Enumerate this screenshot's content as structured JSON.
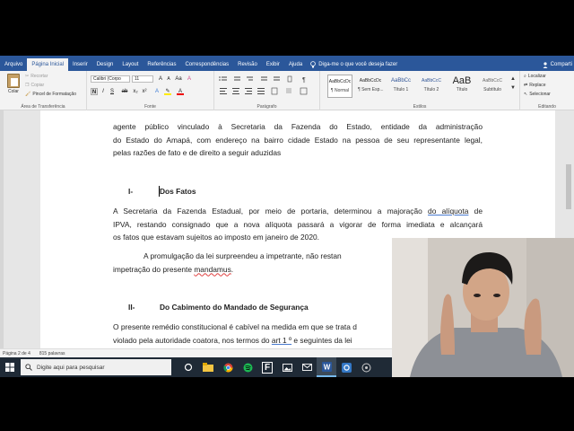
{
  "ribbon_tabs": [
    "Arquivo",
    "Página Inicial",
    "Inserir",
    "Design",
    "Layout",
    "Referências",
    "Correspondências",
    "Revisão",
    "Exibir",
    "Ajuda"
  ],
  "tell_me": "Diga-me o que você deseja fazer",
  "share": "Comparti",
  "clipboard": {
    "paste": "Colar",
    "cut": "Recortar",
    "copy": "Copiar",
    "format_painter": "Pincel de Formatação",
    "label": "Área de Transferência"
  },
  "font": {
    "name": "Calibri (Corpo",
    "size": "11",
    "label": "Fonte"
  },
  "paragraph_label": "Parágrafo",
  "styles": {
    "label": "Estilos",
    "items": [
      {
        "preview": "AaBbCcDc",
        "name": "¶ Normal"
      },
      {
        "preview": "AaBbCcDc",
        "name": "¶ Sem Esp..."
      },
      {
        "preview": "AaBbCc",
        "name": "Título 1"
      },
      {
        "preview": "AaBbCcC",
        "name": "Título 2"
      },
      {
        "preview": "AaB",
        "name": "Título"
      },
      {
        "preview": "AaBbCcC",
        "name": "Subtítulo"
      }
    ]
  },
  "editing": {
    "find": "Localizar",
    "replace": "Replace",
    "select": "Selecionar",
    "label": "Editando"
  },
  "document": {
    "p1": [
      "agente público vinculado à Secretaria da Fazenda do Estado, entidade da administração",
      "do Estado do Amapá, com endereço na bairro cidade Estado na pessoa de seu representante legal,",
      "pelas razões de fato e de direito a seguir aduzidas"
    ],
    "h1_num": "I-",
    "h1_title": "Dos Fatos",
    "p2_l1a": "A Secretaria da Fazenda Estadual, por meio de portaria, determinou a majoração ",
    "p2_l1b": "do alíquota",
    "p2_l1c": " de",
    "p2_l2": "IPVA, restando consignado que a nova alíquota passará a vigorar de forma imediata e alcançará",
    "p2_l3": "os fatos que estavam sujeitos ao imposto em janeiro de 2020.",
    "p3_l1": "A promulgação da lei surpreendeu a impetrante, não restan",
    "p3_l2a": "impetração do presente ",
    "p3_l2b": "mandamus",
    "p3_l2c": ".",
    "h2_num": "II-",
    "h2_title": "Do Cabimento do Mandado de Segurança",
    "p4_l1": "O presente remédio constitucional é cabível na medida em que se trata d",
    "p4_l2a": "violado pela autoridade coatora, nos termos do ",
    "p4_l2b": "art 1 º",
    "p4_l2c": " e seguintes da lei"
  },
  "status": {
    "page": "Página 2 de 4",
    "words": "815 palavras"
  },
  "taskbar": {
    "search_placeholder": "Digite aqui para pesquisar"
  }
}
